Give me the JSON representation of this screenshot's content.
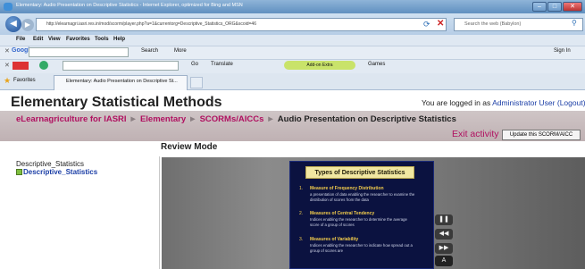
{
  "browser": {
    "title": "Elementary: Audio Presentation on Descriptive Statistics - Internet Explorer, optimized for Bing and MSN",
    "address": "http://elearnagri.iasri.res.in/mod/scorm/player.php?a=1&currentorg=Descriptive_Statistics_ORG&scoid=46",
    "search_placeholder": "Search the web (Babylon)",
    "tab_label": "Elementary: Audio Presentation on Descriptive St...",
    "favorites": "Favorites"
  },
  "menu": [
    "File",
    "Edit",
    "View",
    "Favorites",
    "Tools",
    "Help"
  ],
  "toolbar": {
    "google": "Google",
    "search": "Search",
    "more": "More",
    "sign_in": "Sign In",
    "go": "Go",
    "translate": "Translate",
    "games": "Games",
    "addon": "Add-on Extra"
  },
  "page": {
    "site_title": "Elementary Statistical Methods",
    "login_prefix": "You are logged in as",
    "login_user": "Administrator User",
    "logout": "(Logout)",
    "crumbs": [
      "eLearnagriculture for IASRI",
      "Elementary",
      "SCORMs/AICCs"
    ],
    "crumb_last": "Audio Presentation on Descriptive Statistics",
    "exit": "Exit activity",
    "update_btn": "Update this SCORM/AICC",
    "review_mode": "Review Mode",
    "toc_title": "Descriptive_Statistics",
    "toc_item": "Descriptive_Statistics"
  },
  "slide": {
    "title": "Types of Descriptive Statistics",
    "items": [
      {
        "num": "1.",
        "head": "Measure of Frequency Distribution",
        "body": "a presentation of data enabling the researcher to examine the distribution of scores from the data"
      },
      {
        "num": "2.",
        "head": "Measures of Central Tendency",
        "body": "Indices enabling the researcher to determine the average score of a group of scores"
      },
      {
        "num": "3.",
        "head": "Measures of Variability",
        "body": "Indices enabling the researcher to indicate how spread out a group of scores are"
      }
    ]
  }
}
